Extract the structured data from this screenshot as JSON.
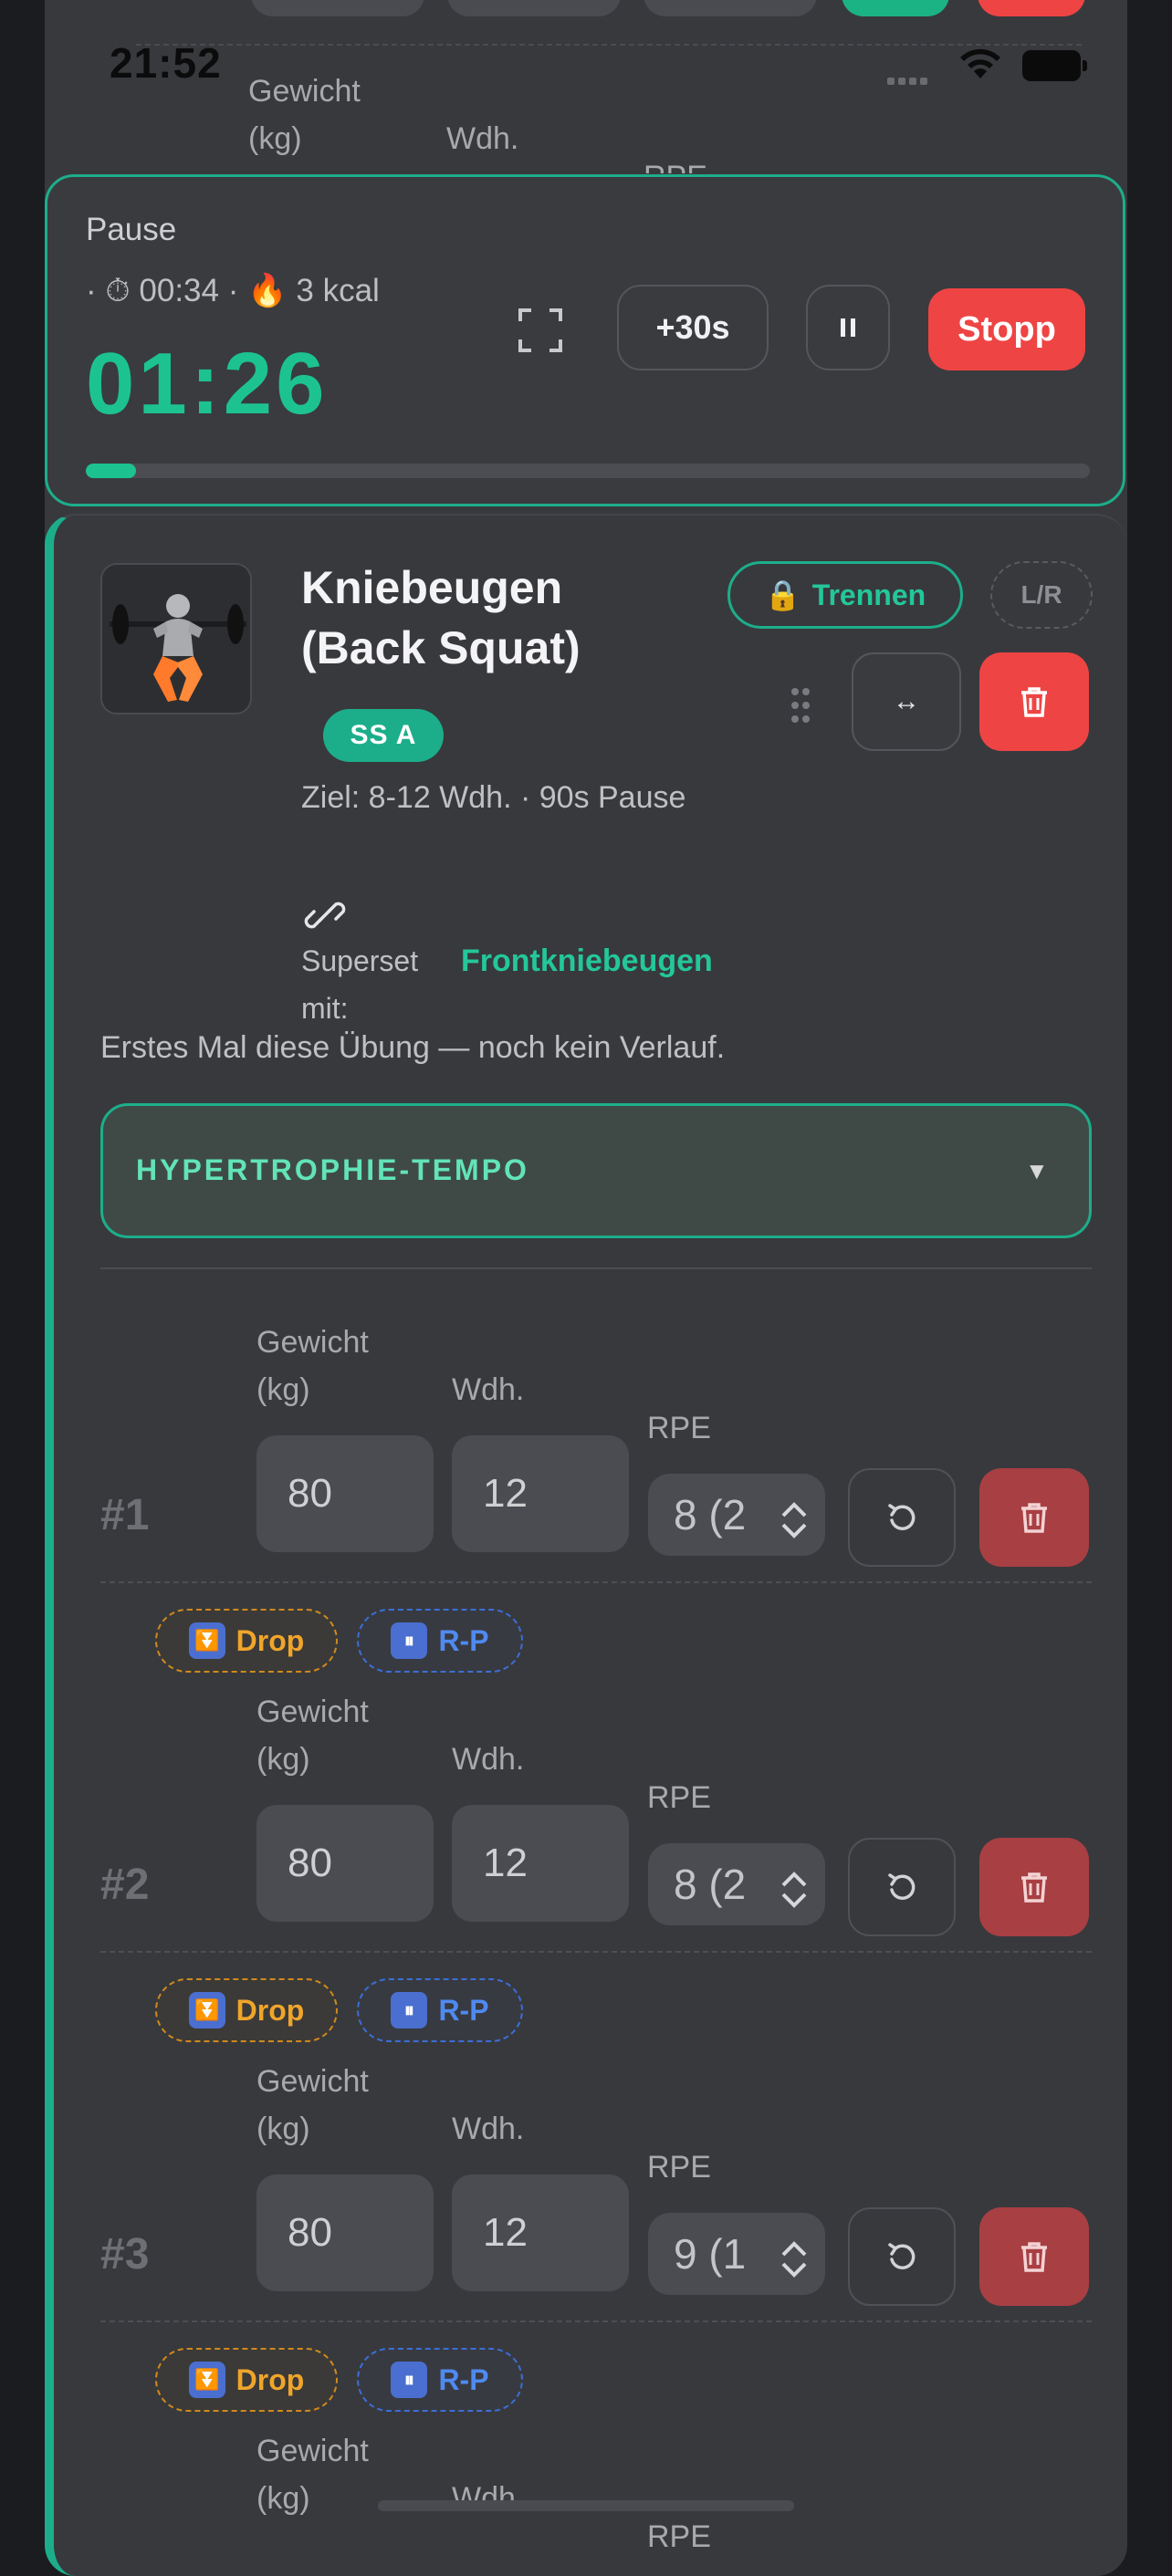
{
  "status_bar": {
    "time": "21:52"
  },
  "prev_exercise": {
    "weight_label": "Gewicht",
    "weight_unit": "(kg)",
    "reps_label": "Wdh.",
    "rpe_label": "RPE"
  },
  "timer": {
    "title": "Pause",
    "stats": "· ⏱ 00:34 · 🔥 3 kcal",
    "remaining": "01:26",
    "add_label": "+30s",
    "pause_icon": "pause-icon",
    "stop_label": "Stopp",
    "progress": 0.05,
    "accent": "#1cc390"
  },
  "exercise": {
    "name": "Kniebeugen (Back Squat)",
    "superset_badge": "SS A",
    "separate_label": "Trennen",
    "lr_label": "L/R",
    "goal": "Ziel: 8-12 Wdh. · 90s Pause",
    "superset_with_label": "Superset mit:",
    "superset_partner": "Frontkniebeugen",
    "history_note": "Erstes Mal diese Übung — noch kein Verlauf.",
    "tempo_label": "HYPERTROPHIE-TEMPO"
  },
  "sets": [
    {
      "number": "#1",
      "weight": "80",
      "reps": "12",
      "rpe": "8 (2"
    },
    {
      "number": "#2",
      "weight": "80",
      "reps": "12",
      "rpe": "8 (2"
    },
    {
      "number": "#3",
      "weight": "80",
      "reps": "12",
      "rpe": "9 (1"
    }
  ],
  "set_labels": {
    "weight_label": "Gewicht",
    "weight_unit": "(kg)",
    "reps_label": "Wdh.",
    "rpe_label": "RPE"
  },
  "tags": {
    "drop": "Drop",
    "rest_pause": "R-P"
  },
  "colors": {
    "accent": "#1cae8a",
    "danger": "#ef4444",
    "drop": "#f0a52a",
    "rest_pause": "#4f8af0",
    "background": "#38393d"
  }
}
